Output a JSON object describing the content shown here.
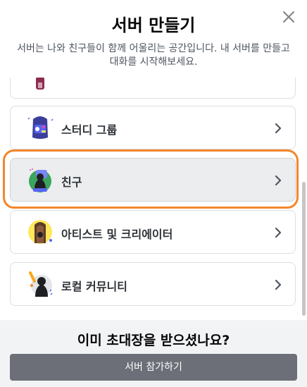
{
  "header": {
    "title": "서버 만들기",
    "subtitle": "서버는 나와 친구들이 함께 어울리는 공간입니다. 내 서버를 만들고 대화를 시작해보세요."
  },
  "options": [
    {
      "label": "",
      "icon": "partial-template-icon"
    },
    {
      "label": "스터디 그룹",
      "icon": "backpack-icon"
    },
    {
      "label": "친구",
      "icon": "friends-character-icon"
    },
    {
      "label": "아티스트 및 크리에이터",
      "icon": "creator-doorway-icon"
    },
    {
      "label": "로컬 커뮤니티",
      "icon": "local-community-icon"
    }
  ],
  "footer": {
    "question": "이미 초대장을 받으셨나요?",
    "join_label": "서버 참가하기"
  },
  "colors": {
    "highlight": "#f3862a",
    "button": "#6d6f78"
  }
}
